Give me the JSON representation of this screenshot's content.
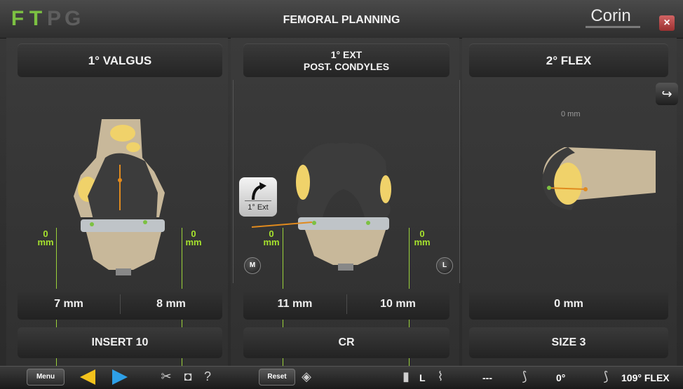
{
  "header": {
    "steps": [
      "F",
      "T",
      "P",
      "G"
    ],
    "title": "FEMORAL PLANNING",
    "brand": "Corin",
    "close_icon": "×"
  },
  "panels": {
    "left": {
      "header": "1° VALGUS",
      "gap_left": "7 mm",
      "gap_right": "8 mm",
      "footer": "INSERT 10",
      "mm_label": "mm",
      "mm_value": "0"
    },
    "center": {
      "header_line1": "1° EXT",
      "header_line2": "POST. CONDYLES",
      "gap_left": "11 mm",
      "gap_right": "10 mm",
      "footer": "CR",
      "rotate_label": "1° Ext",
      "medial": "M",
      "lateral": "L",
      "mm_label": "mm",
      "mm_value": "0"
    },
    "right": {
      "header": "2° FLEX",
      "gap": "0 mm",
      "footer": "SIZE 3",
      "ghost_value": "0 mm"
    }
  },
  "bottombar": {
    "menu": "Menu",
    "reset": "Reset",
    "help": "?",
    "side": "L",
    "dashes": "---",
    "angle": "0°",
    "flex": "109° FLEX"
  },
  "colors": {
    "accent_green": "#7cc142",
    "measure_green": "#a6e22e",
    "bone_yellow": "#f0d26a",
    "implant_gray": "#3c3c3c"
  }
}
